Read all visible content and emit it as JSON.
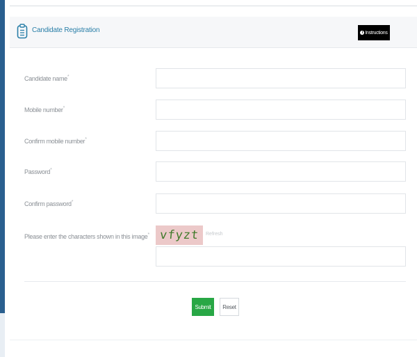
{
  "header": {
    "title": "Candidate Registration",
    "instructions_label": "Instructions",
    "icon": "clipboard-icon"
  },
  "form": {
    "candidate_name_label": "Candidate name",
    "mobile_number_label": "Mobile number",
    "confirm_mobile_label": "Confirm mobile number",
    "password_label": "Password",
    "confirm_password_label": "Confirm password",
    "captcha_label": "Please enter the characters shown in this image",
    "required_marker": "*",
    "captcha_text": "vfyzt",
    "refresh_label": "Refresh",
    "candidate_name_value": "",
    "mobile_number_value": "",
    "confirm_mobile_value": "",
    "password_value": "",
    "confirm_password_value": "",
    "captcha_value": ""
  },
  "actions": {
    "submit_label": "Submit",
    "reset_label": "Reset"
  },
  "colors": {
    "accent": "#2a7fa8",
    "submit": "#28a745",
    "sidebar": "#2a5f8f",
    "captcha_bg": "#ecc9c9",
    "captcha_text": "#3f7a2a"
  }
}
